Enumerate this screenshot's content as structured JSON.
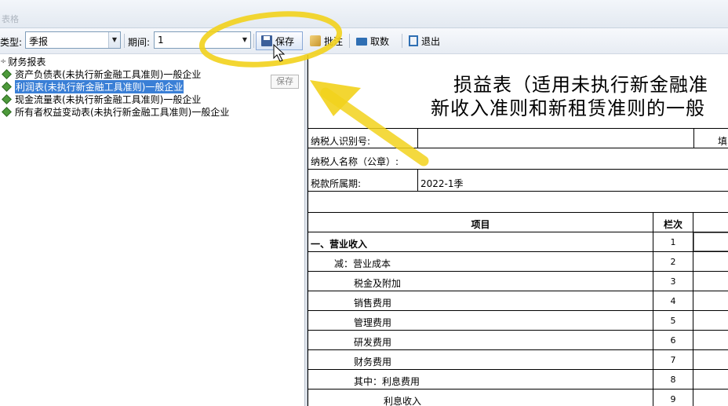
{
  "window": {
    "title": "表格"
  },
  "toolbar": {
    "type_label": "类型:",
    "type_value": "季报",
    "period_label": "期间:",
    "period_value": "1",
    "save": "保存",
    "approve": "批注",
    "fetch": "取数",
    "exit": "退出"
  },
  "tree": {
    "root": "财务报表",
    "items": [
      {
        "label": "资产负债表(未执行新金融工具准则)一般企业",
        "selected": false
      },
      {
        "label": "利润表(未执行新金融工具准则)一般企业",
        "selected": true
      },
      {
        "label": "现金流量表(未执行新金融工具准则)一般企业",
        "selected": false
      },
      {
        "label": "所有者权益变动表(未执行新金融工具准则)一般企业",
        "selected": false
      }
    ]
  },
  "tooltip": "保存",
  "form": {
    "title_line1": "损益表（适用未执行新金融准",
    "title_line2": "新收入准则和新租赁准则的一般",
    "taxpayer_id_label": "纳税人识别号:",
    "taxpayer_id_value": "",
    "taxpayer_name_label": "纳税人名称（公章）:",
    "tax_period_label": "税款所属期:",
    "tax_period_value": "2022-1季",
    "right_partial": "填",
    "col_item": "项目",
    "col_line": "栏次",
    "rows": [
      {
        "item": "一、营业收入",
        "line": "1"
      },
      {
        "item": "减：营业成本",
        "line": "2"
      },
      {
        "item": "税金及附加",
        "line": "3"
      },
      {
        "item": "销售费用",
        "line": "4"
      },
      {
        "item": "管理费用",
        "line": "5"
      },
      {
        "item": "研发费用",
        "line": "6"
      },
      {
        "item": "财务费用",
        "line": "7"
      },
      {
        "item": "其中：利息费用",
        "line": "8"
      },
      {
        "item": "利息收入",
        "line": "9"
      }
    ]
  },
  "colors": {
    "selection": "#3a7fd6",
    "highlight": "#f2d21c"
  }
}
